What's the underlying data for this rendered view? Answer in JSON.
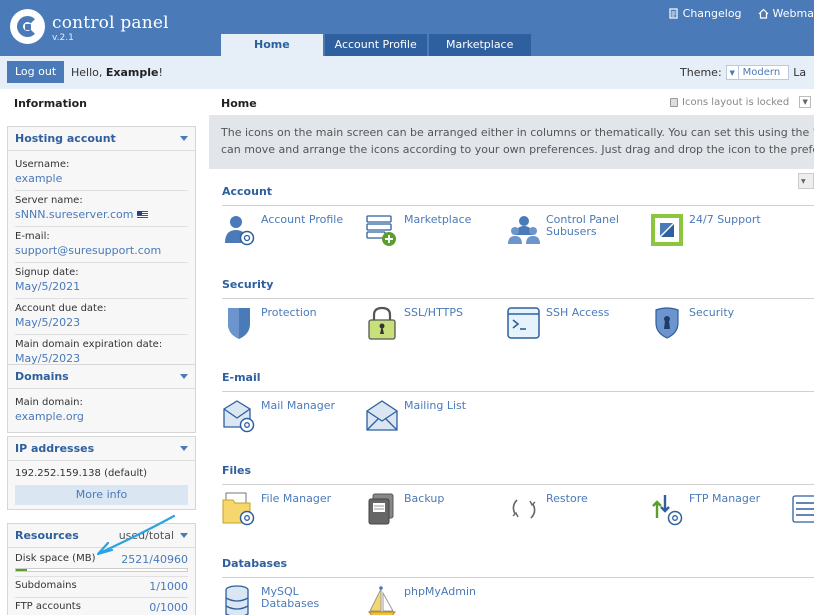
{
  "header": {
    "brand_title": "control panel",
    "brand_version": "v.2.1",
    "links": [
      "Changelog",
      "Webma"
    ],
    "tabs": [
      "Home",
      "Account Profile",
      "Marketplace"
    ]
  },
  "userbar": {
    "logout_label": "Log out",
    "hello_prefix": "Hello, ",
    "hello_name": "Example",
    "hello_suffix": "!",
    "theme_label": "Theme:",
    "theme_value": "Modern",
    "lang_fragment": "La"
  },
  "sidebar": {
    "heading": "Information",
    "hosting": {
      "title": "Hosting account",
      "fields": [
        {
          "label": "Username:",
          "value": "example"
        },
        {
          "label": "Server name:",
          "value": "sNNN.sureserver.com"
        },
        {
          "label": "E-mail:",
          "value": "support@suresupport.com"
        },
        {
          "label": "Signup date:",
          "value": "May/5/2021"
        },
        {
          "label": "Account due date:",
          "value": "May/5/2023"
        },
        {
          "label": "Main domain expiration date:",
          "value": "May/5/2023"
        }
      ]
    },
    "domains": {
      "title": "Domains",
      "label": "Main domain:",
      "value": "example.org"
    },
    "ip": {
      "title": "IP addresses",
      "value": "192.252.159.138 (default)",
      "more_info": "More info"
    },
    "resources": {
      "title": "Resources",
      "right": "used/total",
      "rows": [
        {
          "label": "Disk space (MB)",
          "value": "2521/40960",
          "fraction": 0.0615,
          "bar": true
        },
        {
          "label": "Subdomains",
          "value": "1/1000",
          "bar": false
        },
        {
          "label": "FTP accounts",
          "value": "0/1000",
          "bar": false
        }
      ]
    }
  },
  "main": {
    "heading": "Home",
    "locked_label": "Icons layout is locked",
    "info_line1": "The icons on the main screen can be arranged either in columns or thematically. You can set this using the \"scre",
    "info_line2": "can move and arrange the icons according to your own preferences. Just drag and drop the icon to the preferred",
    "sections": [
      {
        "title": "Account",
        "items": [
          {
            "label": "Account Profile",
            "icon": "account-profile-icon"
          },
          {
            "label": "Marketplace",
            "icon": "marketplace-icon"
          },
          {
            "label": "Control Panel Subusers",
            "icon": "subusers-icon"
          },
          {
            "label": "24/7 Support",
            "icon": "support-icon"
          }
        ]
      },
      {
        "title": "Security",
        "items": [
          {
            "label": "Protection",
            "icon": "shield-icon"
          },
          {
            "label": "SSL/HTTPS",
            "icon": "padlock-icon"
          },
          {
            "label": "SSH Access",
            "icon": "terminal-icon"
          },
          {
            "label": "Security",
            "icon": "security-badge-icon"
          }
        ]
      },
      {
        "title": "E-mail",
        "items": [
          {
            "label": "Mail Manager",
            "icon": "mail-manager-icon"
          },
          {
            "label": "Mailing List",
            "icon": "envelope-icon"
          }
        ]
      },
      {
        "title": "Files",
        "items": [
          {
            "label": "File Manager",
            "icon": "file-manager-icon"
          },
          {
            "label": "Backup",
            "icon": "backup-icon"
          },
          {
            "label": "Restore",
            "icon": "restore-icon"
          },
          {
            "label": "FTP Manager",
            "icon": "ftp-manager-icon"
          }
        ]
      },
      {
        "title": "Databases",
        "items": [
          {
            "label": "MySQL Databases",
            "icon": "database-icon"
          },
          {
            "label": "phpMyAdmin",
            "icon": "phpmyadmin-icon"
          }
        ]
      }
    ]
  },
  "colors": {
    "brand_blue": "#4a7ab8",
    "dark_blue": "#2e5f9e",
    "light_blue_bg": "#e6eef8",
    "support_green": "#8cc63f",
    "progress_green": "#5a9e2c",
    "annotation_arrow": "#2aa3e0"
  }
}
